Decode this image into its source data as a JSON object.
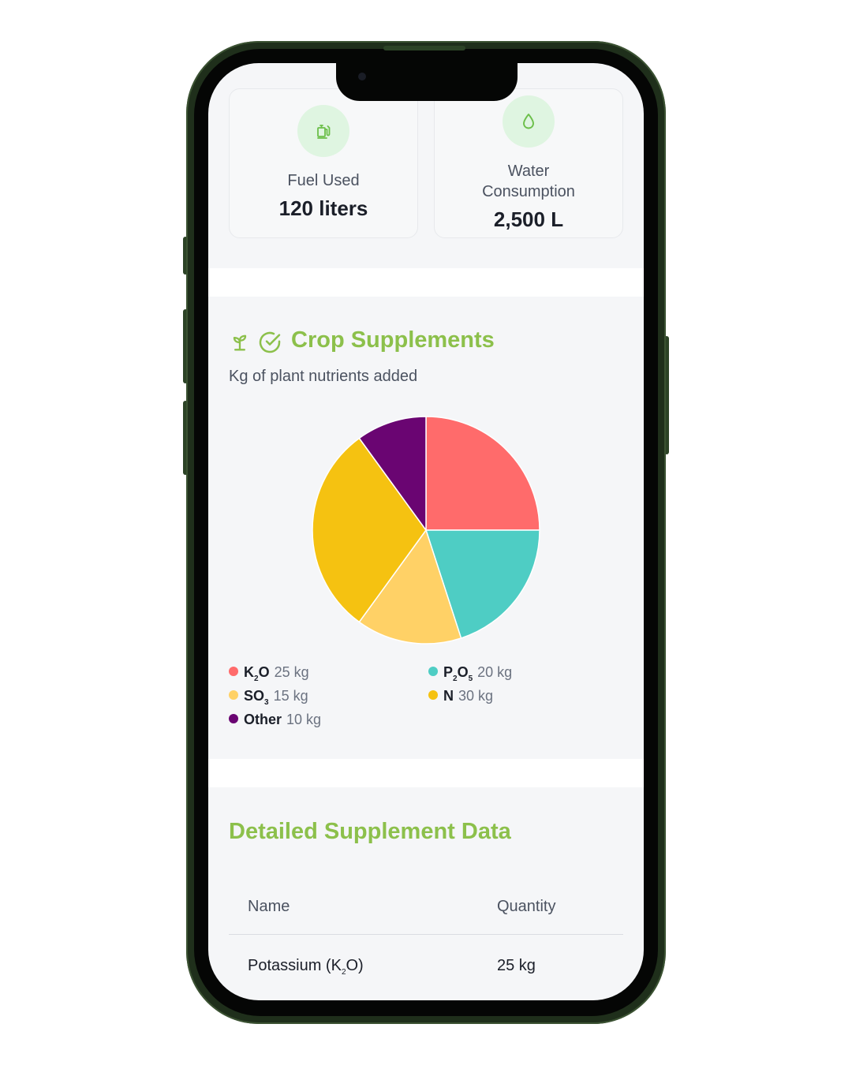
{
  "stats": {
    "fuel": {
      "label": "Fuel Used",
      "value": "120 liters",
      "icon": "fuel-icon"
    },
    "water": {
      "label_line1": "Water",
      "label_line2": "Consumption",
      "value": "2,500 L",
      "icon": "water-drop-icon"
    }
  },
  "crop_section": {
    "title": "Crop Supplements",
    "subtitle": "Kg of plant nutrients added",
    "icons": [
      "sprout-icon",
      "check-circle-icon"
    ]
  },
  "chart_data": {
    "type": "pie",
    "slices": [
      {
        "label": "K2O",
        "value": 25,
        "unit": "kg",
        "color": "#ff6b6b"
      },
      {
        "label": "P2O5",
        "value": 20,
        "unit": "kg",
        "color": "#4ecdc4"
      },
      {
        "label": "SO3",
        "value": 15,
        "unit": "kg",
        "color": "#ffd166"
      },
      {
        "label": "N",
        "value": 30,
        "unit": "kg",
        "color": "#f5c211"
      },
      {
        "label": "Other",
        "value": 10,
        "unit": "kg",
        "color": "#6a0572"
      }
    ],
    "legend_placement": "bottom"
  },
  "legend": {
    "k2o": {
      "base1": "K",
      "sub1": "2",
      "base2": "O",
      "value": "25 kg"
    },
    "p2o5": {
      "base1": "P",
      "sub1": "2",
      "base2": "O",
      "sub2": "5",
      "value": "20 kg"
    },
    "so3": {
      "base1": "SO",
      "sub1": "3",
      "value": "15 kg"
    },
    "n": {
      "base1": "N",
      "value": "30 kg"
    },
    "other": {
      "base1": "Other",
      "value": "10 kg"
    }
  },
  "table": {
    "title": "Detailed Supplement Data",
    "headers": {
      "name": "Name",
      "quantity": "Quantity"
    },
    "rows": [
      {
        "name_pre": "Potassium (K",
        "name_sub": "2",
        "name_post": "O)",
        "quantity": "25 kg"
      }
    ]
  }
}
